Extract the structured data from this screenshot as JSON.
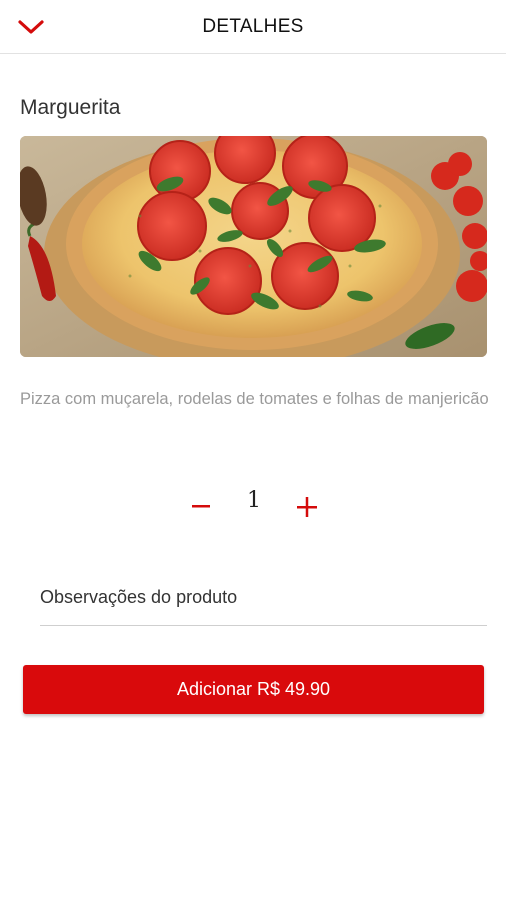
{
  "header": {
    "title": "DETALHES",
    "back_icon": "chevron-down-icon"
  },
  "product": {
    "name": "Marguerita",
    "image_subject": "pizza-margherita",
    "description": "Pizza com muçarela, rodelas de tomates e folhas de manjericão"
  },
  "quantity": {
    "value": "1",
    "minus_label": "−",
    "plus_label": "+"
  },
  "notes": {
    "placeholder": "Observações do produto",
    "value": ""
  },
  "add_button": {
    "label": "Adicionar R$ 49.90"
  },
  "colors": {
    "accent": "#d90a0c",
    "header_icon": "#d40b0b",
    "description_text": "#9a9a9a"
  }
}
